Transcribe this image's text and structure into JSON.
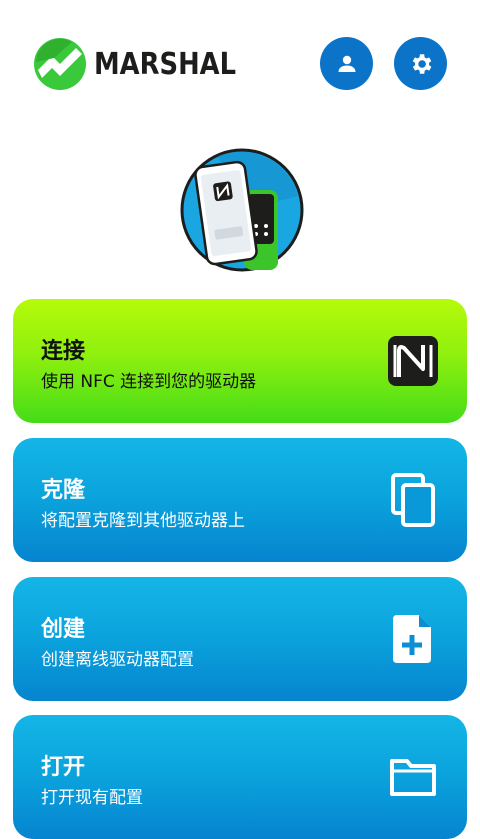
{
  "header": {
    "brand": "MARSHAL",
    "icons": {
      "user": "user-icon",
      "settings": "gear-icon"
    }
  },
  "colors": {
    "accent_blue": "#0b74c9",
    "card_green_top": "#b6fa0a",
    "card_green_bottom": "#45dc18",
    "card_blue_top": "#14b6e6",
    "card_blue_bottom": "#0684cf"
  },
  "cards": [
    {
      "title": "连接",
      "subtitle": "使用 NFC 连接到您的驱动器",
      "icon": "nfc-icon"
    },
    {
      "title": "克隆",
      "subtitle": "将配置克隆到其他驱动器上",
      "icon": "copy-icon"
    },
    {
      "title": "创建",
      "subtitle": "创建离线驱动器配置",
      "icon": "new-file-icon"
    },
    {
      "title": "打开",
      "subtitle": "打开现有配置",
      "icon": "folder-icon"
    }
  ]
}
